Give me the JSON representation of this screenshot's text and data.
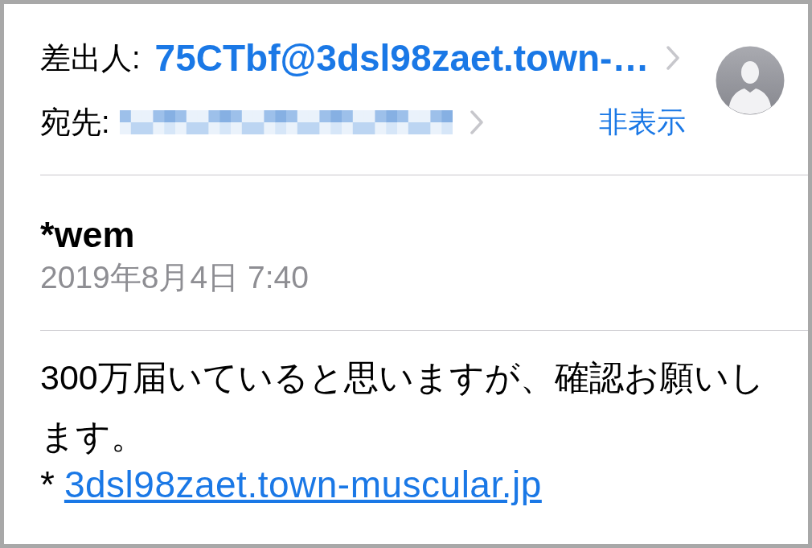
{
  "header": {
    "from": {
      "label": "差出人:",
      "address": "75CTbf@3dsl98zaet.town-…"
    },
    "to": {
      "label": "宛先:"
    },
    "hide_link": "非表示"
  },
  "message": {
    "subject": "*wem",
    "date": "2019年8月4日 7:40"
  },
  "body": {
    "text": "300万届いていると思いますが、確認お願いします。",
    "link_prefix": "*",
    "link": "3dsl98zaet.town-muscular.jp"
  }
}
